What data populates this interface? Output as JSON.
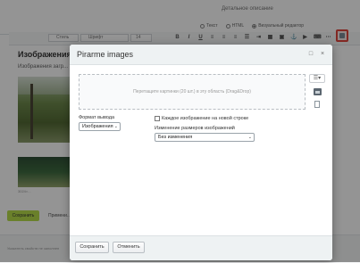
{
  "background": {
    "detail_heading": "Детальное описание",
    "radio_options": [
      {
        "label": "Текст",
        "checked": false
      },
      {
        "label": "HTML",
        "checked": false
      },
      {
        "label": "Визуальный редактор",
        "checked": true
      }
    ],
    "toolbar": {
      "font_family": "Стиль",
      "font_name": "Шрифт",
      "font_size": "14"
    },
    "section_title": "Изображения",
    "section_subtitle": "Изображения загр...",
    "caption": "3024×...",
    "save_label": "Сохранить",
    "apply_label": "Примени...",
    "footer_text": "Указатель свойств не заполнен"
  },
  "dialog": {
    "title": "Pirarme images",
    "dropzone_text": "Перетащите картинки (20 шт.) в эту область (Drag&Drop)",
    "output_format_label": "Формат вывода",
    "output_format_value": "Изображения",
    "each_on_new_line_label": "Каждое изображение на новой строке",
    "resize_label": "Изменение размеров изображений",
    "resize_value": "Без изменения",
    "save_button": "Сохранить",
    "cancel_button": "Отменить",
    "minimize_glyph": "□",
    "close_glyph": "×",
    "view_glyph": "☰▾"
  },
  "colors": {
    "accent_red": "#e0453d",
    "save_green": "#b7dd4b",
    "dialog_header": "#eef2f3"
  }
}
